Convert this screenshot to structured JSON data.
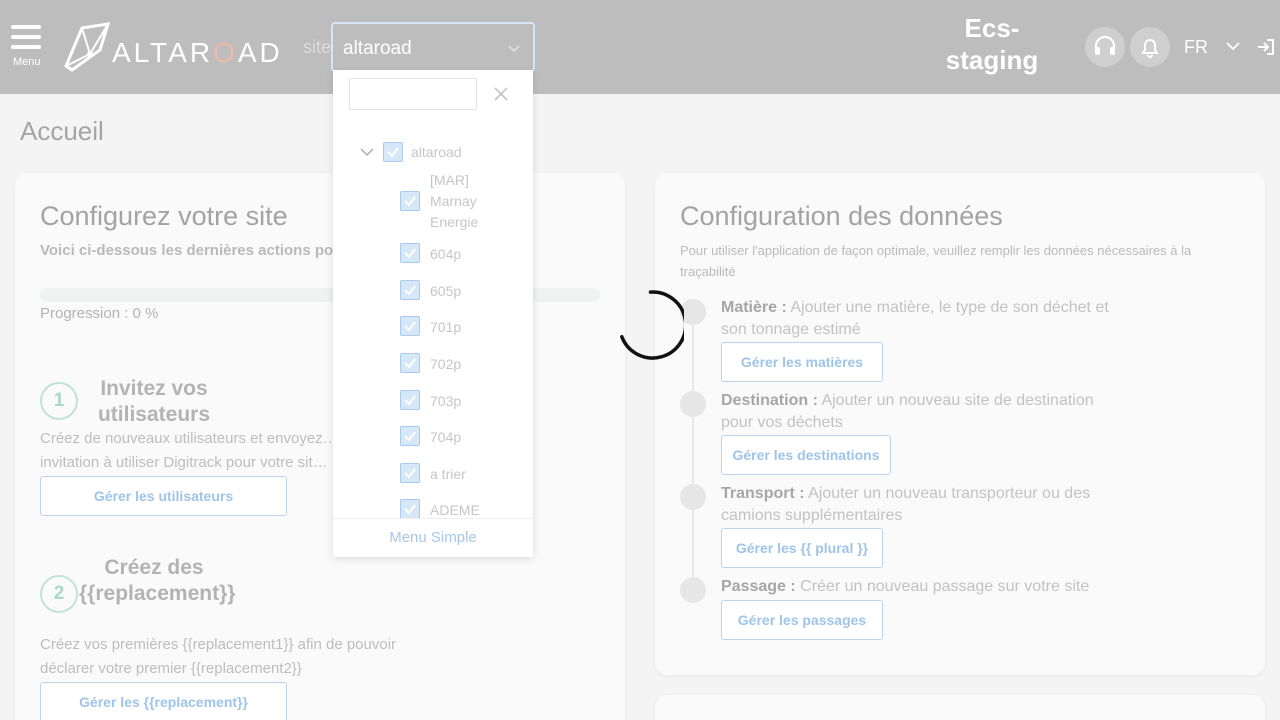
{
  "header": {
    "menu_label": "Menu",
    "logo_text_before": "ALTAR",
    "logo_text_o": "O",
    "logo_text_after": "AD",
    "site_label": "site",
    "site_value": "altaroad",
    "env_name": "Ecs-staging",
    "language": "FR"
  },
  "page": {
    "title": "Accueil"
  },
  "setup_card": {
    "title": "Configurez votre site",
    "intro": "Voici ci-dessous les dernières actions po… …on de votre site",
    "progress_label": "Progression : 0 %",
    "progress_value": 0,
    "steps": [
      {
        "number": "1",
        "title": "Invitez vos utilisateurs",
        "description": "Créez de nouveaux utilisateurs et envoyez… invitation à utiliser Digitrack pour votre sit…",
        "button": "Gérer les utilisateurs"
      },
      {
        "number": "2",
        "title": "Créez des {{replacement}}",
        "description": "Créez vos premières {{replacement1}} afin de pouvoir déclarer votre premier {{replacement2}}",
        "button": "Gérer les {{replacement}}"
      }
    ]
  },
  "data_card": {
    "title": "Configuration des données",
    "subtitle": "Pour utiliser l'application de façon optimale, veuillez remplir les données nécessaires à la traçabilité",
    "items": [
      {
        "label": "Matière :",
        "text": " Ajouter une matière, le type de son déchet et son tonnage estimé",
        "button": "Gérer les matières"
      },
      {
        "label": "Destination :",
        "text": " Ajouter un nouveau site de destination pour vos déchets",
        "button": "Gérer les destinations"
      },
      {
        "label": "Transport :",
        "text": " Ajouter un nouveau transporteur ou des camions supplémentaires",
        "button": "Gérer les {{ plural }}"
      },
      {
        "label": "Passage :",
        "text": " Créer un nouveau passage sur votre site",
        "button": "Gérer les passages"
      }
    ]
  },
  "site_dropdown": {
    "search_value": "",
    "root": "altaroad",
    "items": [
      "[MAR] Marnay Energie",
      "604p",
      "605p",
      "701p",
      "702p",
      "703p",
      "704p",
      "a trier",
      "ADEME"
    ],
    "footer": "Menu Simple"
  },
  "icons": {
    "menu": "hamburger-icon",
    "support": "headset-icon",
    "notifications": "bell-icon",
    "language_toggle": "chevron-down-icon",
    "logout": "logout-icon",
    "loading": "spinner-icon"
  },
  "colors": {
    "header_bg": "#bdbdbd",
    "accent_blue": "#9fc4ea",
    "accent_green": "#a9d7c8",
    "logo_accent": "#f0b8a6"
  }
}
